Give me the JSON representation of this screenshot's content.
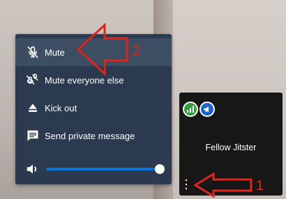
{
  "menu": {
    "items": [
      {
        "label": "Mute",
        "icon": "mic-off-icon",
        "highlighted": true
      },
      {
        "label": "Mute everyone else",
        "icon": "mic-off-multiple-icon",
        "highlighted": false
      },
      {
        "label": "Kick out",
        "icon": "eject-icon",
        "highlighted": false
      },
      {
        "label": "Send private message",
        "icon": "chat-icon",
        "highlighted": false
      }
    ],
    "volume": {
      "icon": "speaker-icon",
      "level": 1.0
    }
  },
  "tile": {
    "name": "Fellow Jitster",
    "badges": [
      {
        "icon": "signal-bars-icon",
        "color": "#2f9e3a"
      },
      {
        "icon": "megaphone-icon",
        "color": "#1a63d8"
      }
    ]
  },
  "annotations": {
    "step1": "1",
    "step2": "2",
    "color": "#e1241b"
  }
}
